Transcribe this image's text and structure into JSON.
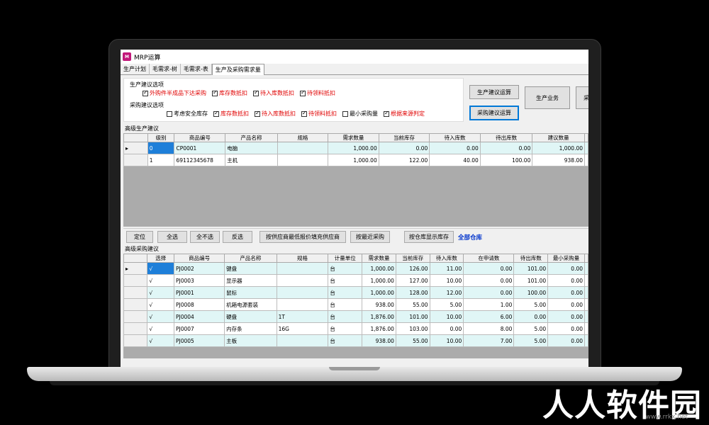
{
  "window": {
    "icon_text": "M",
    "title": "MRP运算"
  },
  "tabs": [
    "生产计划",
    "毛需求-树",
    "毛需求-表",
    "生产及采购需求量"
  ],
  "production_options": {
    "legend": "生产建议选项",
    "items": [
      {
        "label": "外购件半成品下达采购",
        "checked": true
      },
      {
        "label": "库存数抵扣",
        "checked": true
      },
      {
        "label": "待入库数抵扣",
        "checked": true
      },
      {
        "label": "待领料抵扣",
        "checked": true
      }
    ]
  },
  "purchase_options": {
    "legend": "采购建议选项",
    "items": [
      {
        "label": "考虑安全库存",
        "checked": false
      },
      {
        "label": "库存数抵扣",
        "checked": true
      },
      {
        "label": "待入库数抵扣",
        "checked": true
      },
      {
        "label": "待领料抵扣",
        "checked": true
      },
      {
        "label": "最小采购量",
        "checked": false
      },
      {
        "label": "根据来源判定",
        "checked": true
      }
    ]
  },
  "buttons": {
    "production_calc": "生产建议运算",
    "purchase_calc": "采购建议运算",
    "production_business": "生产业务",
    "purchase_business": "采"
  },
  "production_grid": {
    "label": "高级生产建议",
    "columns": [
      "级别",
      "商品编号",
      "产品名称",
      "规格",
      "需求数量",
      "当前库存",
      "待入库数",
      "待出库数",
      "建议数量"
    ],
    "rows": [
      [
        "0",
        "CP0001",
        "电脑",
        "",
        "1,000.00",
        "0.00",
        "0.00",
        "0.00",
        "1,000.00"
      ],
      [
        "1",
        "69112345678",
        "主机",
        "",
        "1,000.00",
        "122.00",
        "40.00",
        "100.00",
        "938.00"
      ]
    ]
  },
  "toolbar": {
    "locate": "定位",
    "select_all": "全选",
    "deselect_all": "全不选",
    "invert": "反选",
    "fill_lowest_supplier": "按供应商最低报价填充供应商",
    "recent_purchase": "按最近采购",
    "show_by_warehouse": "按仓库显示库存",
    "all_warehouses": "全部仓库"
  },
  "purchase_grid": {
    "label": "高级采购建议",
    "columns": [
      "选择",
      "商品编号",
      "产品名称",
      "规格",
      "计量单位",
      "需求数量",
      "当前库存",
      "待入库数",
      "在申请数",
      "待出库数",
      "最小采购量"
    ],
    "rows": [
      [
        "√",
        "PJ0002",
        "键盘",
        "",
        "台",
        "1,000.00",
        "126.00",
        "11.00",
        "0.00",
        "101.00",
        "0.00"
      ],
      [
        "√",
        "PJ0003",
        "显示器",
        "",
        "台",
        "1,000.00",
        "127.00",
        "10.00",
        "0.00",
        "101.00",
        "0.00"
      ],
      [
        "√",
        "PJ0001",
        "鼠标",
        "",
        "台",
        "1,000.00",
        "128.00",
        "12.00",
        "0.00",
        "100.00",
        "0.00"
      ],
      [
        "√",
        "PJ0008",
        "机箱电源套装",
        "",
        "台",
        "938.00",
        "55.00",
        "5.00",
        "1.00",
        "5.00",
        "0.00"
      ],
      [
        "√",
        "PJ0004",
        "硬盘",
        "1T",
        "台",
        "1,876.00",
        "101.00",
        "10.00",
        "6.00",
        "0.00",
        "0.00"
      ],
      [
        "√",
        "PJ0007",
        "内存条",
        "16G",
        "台",
        "1,876.00",
        "103.00",
        "0.00",
        "8.00",
        "5.00",
        "0.00"
      ],
      [
        "√",
        "PJ0005",
        "主板",
        "",
        "台",
        "938.00",
        "55.00",
        "10.00",
        "7.00",
        "5.00",
        "0.00"
      ]
    ]
  },
  "watermark": {
    "text": "人人软件园",
    "url": "www.rrkx.net"
  }
}
